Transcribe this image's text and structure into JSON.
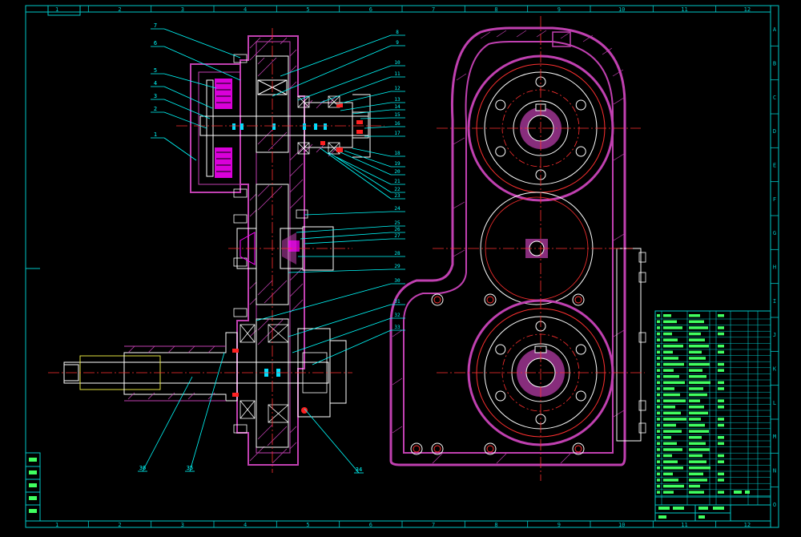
{
  "colors": {
    "background": "#000000",
    "frame": "#00c8c8",
    "outline": "#ffffff",
    "hatch": "#c040b0",
    "centerline": "#ff3030",
    "highlight": "#ff00ff",
    "leader": "#00ffff",
    "blue": "#3060ff",
    "yellow": "#e0e040",
    "green": "#30ff60"
  },
  "frame": {
    "top_zones": [
      "1",
      "2",
      "3",
      "4",
      "5",
      "6",
      "7",
      "8",
      "9",
      "10",
      "11",
      "12"
    ],
    "bottom_zones": [
      "1",
      "2",
      "3",
      "4",
      "5",
      "6",
      "7",
      "8",
      "9",
      "10",
      "11",
      "12"
    ],
    "right_zones": [
      "A",
      "B",
      "C",
      "D",
      "E",
      "F",
      "G",
      "H",
      "I",
      "J",
      "K",
      "L",
      "M",
      "N",
      "O"
    ]
  },
  "callouts_left": [
    "7",
    "6",
    "5",
    "4",
    "3",
    "2",
    "1",
    "35",
    "36",
    "34"
  ],
  "callouts_right": [
    "8",
    "9",
    "10",
    "11",
    "12",
    "13",
    "14",
    "15",
    "16",
    "17",
    "18",
    "19",
    "20",
    "21",
    "22",
    "23",
    "24",
    "25",
    "26",
    "27",
    "28",
    "29",
    "30",
    "31",
    "32",
    "33"
  ]
}
